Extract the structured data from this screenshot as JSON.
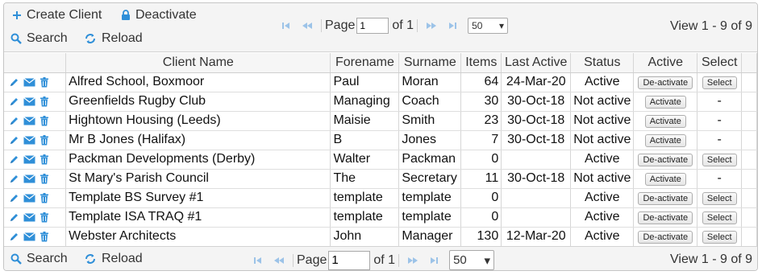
{
  "toolbar": {
    "create_label": "Create Client",
    "deactivate_label": "Deactivate",
    "search_label": "Search",
    "reload_label": "Reload"
  },
  "pager": {
    "page_label": "Page",
    "page_value": "1",
    "of_label": "of 1",
    "rows_value": "50",
    "view_text": "View 1 - 9 of 9"
  },
  "table": {
    "columns": [
      "Client Name",
      "Forename",
      "Surname",
      "Items",
      "Last Active",
      "Status",
      "Active",
      "Select"
    ],
    "rows": [
      {
        "client": "Alfred School, Boxmoor",
        "forename": "Paul",
        "surname": "Moran",
        "items": "64",
        "last_active": "24-Mar-20",
        "status": "Active",
        "action": "De-activate",
        "select": "Select"
      },
      {
        "client": "Greenfields Rugby Club",
        "forename": "Managing",
        "surname": "Coach",
        "items": "30",
        "last_active": "30-Oct-18",
        "status": "Not active",
        "action": "Activate",
        "select": "-"
      },
      {
        "client": "Hightown Housing (Leeds)",
        "forename": "Maisie",
        "surname": "Smith",
        "items": "23",
        "last_active": "30-Oct-18",
        "status": "Not active",
        "action": "Activate",
        "select": "-"
      },
      {
        "client": "Mr B Jones (Halifax)",
        "forename": "B",
        "surname": "Jones",
        "items": "7",
        "last_active": "30-Oct-18",
        "status": "Not active",
        "action": "Activate",
        "select": "-"
      },
      {
        "client": "Packman Developments (Derby)",
        "forename": "Walter",
        "surname": "Packman",
        "items": "0",
        "last_active": "",
        "status": "Active",
        "action": "De-activate",
        "select": "Select"
      },
      {
        "client": "St Mary's Parish Council",
        "forename": "The",
        "surname": "Secretary",
        "items": "11",
        "last_active": "30-Oct-18",
        "status": "Not active",
        "action": "Activate",
        "select": "-"
      },
      {
        "client": "Template BS Survey #1",
        "forename": "template",
        "surname": "template",
        "items": "0",
        "last_active": "",
        "status": "Active",
        "action": "De-activate",
        "select": "Select"
      },
      {
        "client": "Template ISA TRAQ #1",
        "forename": "template",
        "surname": "template",
        "items": "0",
        "last_active": "",
        "status": "Active",
        "action": "De-activate",
        "select": "Select"
      },
      {
        "client": "Webster Architects",
        "forename": "John",
        "surname": "Manager",
        "items": "130",
        "last_active": "12-Mar-20",
        "status": "Active",
        "action": "De-activate",
        "select": "Select"
      }
    ]
  },
  "icons": {
    "plus": "plus-icon",
    "lock": "lock-icon",
    "search": "search-icon",
    "reload": "reload-icon",
    "edit": "pencil-icon",
    "email": "envelope-icon",
    "delete": "trash-icon",
    "first": "first-page-icon",
    "prev": "prev-page-icon",
    "next": "next-page-icon",
    "last": "last-page-icon"
  },
  "colors": {
    "accent": "#2f8fd8",
    "pager_icon": "#9cc3e8"
  }
}
